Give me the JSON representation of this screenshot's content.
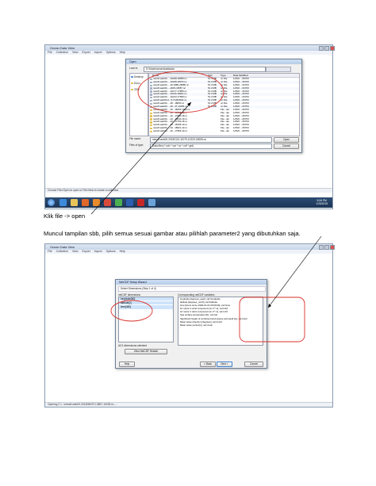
{
  "screenshot1": {
    "app_title": "Ocean Data View",
    "menu": [
      "File",
      "Collection",
      "View",
      "Export",
      "Import",
      "Options",
      "Help"
    ],
    "status_text": "Choose File>Open to open or File>New to create a collection.",
    "dialog": {
      "title": "Open",
      "look_in_label": "Look in:",
      "look_in_value": "D:\\Modelocean\\data\\data",
      "sidebar": [
        "Desktop",
        "Docu...",
        "ODV"
      ],
      "columns": [
        "Name",
        "Size",
        "Type",
        "Date Modified"
      ],
      "files": [
        {
          "name": "netcdf-web00-...-10228-18055.nc",
          "size": "51.3 MB",
          "type": "nc File",
          "date": "1/25/2...:28 PM"
        },
        {
          "name": "netcdf-web00-...-10228-18072.nc",
          "size": "51.3 MB",
          "type": "nc File",
          "date": "1/25/2...:28 PM"
        },
        {
          "name": "netcdf-web00-...-20.0086-28685.nc",
          "size": "51.3 MB",
          "type": "nc File",
          "date": "1/25/2...:30 PM"
        },
        {
          "name": "netcdf-web00-...-2015-18357.nc",
          "size": "51.3 MB",
          "type": "nc File",
          "date": "1/25/2...:30 PM"
        },
        {
          "name": "netcdf-web00-...-10177-17855.nc",
          "size": "51.3 MB",
          "type": "nc File",
          "date": "1/25/2...:30 PM"
        },
        {
          "name": "netcdf-web00-...-10146-18201.nc",
          "size": "51.3 MB",
          "type": "nc File",
          "date": "1/25/2...:29 PM"
        },
        {
          "name": "netcdf-web00-...-10213-17695.nc",
          "size": "51.3 MB",
          "type": "nc File",
          "date": "1/25/2...:29 PM"
        },
        {
          "name": "netcdf-web00-2...5-7148-8911.nc",
          "size": "51.3 MB",
          "type": "nc File",
          "date": "1/25/2...:29 PM"
        },
        {
          "name": "netcdf-web00-...-20...18600.nc",
          "size": "51.3 MB",
          "type": "nc File",
          "date": "1/25/2...:29 PM"
        },
        {
          "name": "netcdf-web00-...-20...27-10251.nc",
          "size": "51.3 MB",
          "type": "nc File",
          "date": "1/25/2...:30 PM"
        },
        {
          "name": "netcdf-web00-...-10...16053-1012.nc",
          "size": "",
          "type": "File...der",
          "date": "1/25/2...:28 PM"
        },
        {
          "name": "netcdf-web00-...-10...13785-16.nc",
          "size": "",
          "type": "File...der",
          "date": "1/25/2...:28 PM"
        },
        {
          "name": "netcdf-web00-...-10...17960-18.nc",
          "size": "",
          "type": "File...der",
          "date": "1/25/2...:28 PM"
        },
        {
          "name": "netcdf-web00-...-10...18030-10.nc",
          "size": "",
          "type": "File...der",
          "date": "1/25/2...:28 PM"
        },
        {
          "name": "netcdf-web00-...-10...17700-16.nc",
          "size": "",
          "type": "File...der",
          "date": "1/25/2...:28 PM"
        },
        {
          "name": "netcdf-web00-...-10...18195-10.nc",
          "size": "",
          "type": "File...der",
          "date": "1/25/2...:28 PM"
        },
        {
          "name": "netcdf-web00-...-10...18021-10.nc",
          "size": "",
          "type": "File...der",
          "date": "1/25/2...:28 PM"
        },
        {
          "name": "netcdf-web00-...-10...17966-10.nc",
          "size": "",
          "type": "File...der",
          "date": "1/25/2...:28 PM"
        }
      ],
      "filename_label": "File name:",
      "filename_value": "netcdf-web00-20150113-11079-10220-18055.nc",
      "filetype_label": "Files of type:",
      "filetype_value": "Data files (*.odv *.var *.nc *.cdf *.grd)",
      "open_label": "Open",
      "cancel_label": "Cancel"
    },
    "clock": "5:06 PM",
    "date": "1/25/2015"
  },
  "caption1": "Klik file -> open",
  "caption2": "Muncul tampilan sbb, pilih semua sesuai gambar atau pilihlah parameter2 yang dibutuhkan saja.",
  "screenshot2": {
    "app_title": "Ocean Data View",
    "menu": [
      "File",
      "Collection",
      "View",
      "Export",
      "Import",
      "Options",
      "Help"
    ],
    "status_text": "Opening C:\\...\\netcdf-web00-20150803T2-3857-10039.nc ...",
    "dialog": {
      "title": "NetCDF Setup Wizard",
      "subtitle": "Select Dimensions (Step 1 of 4)",
      "left_header": "netCDF dimensions",
      "dimensions": [
        "longitude[80]",
        "latitude[2]",
        "time[480]"
      ],
      "selected_info": "All 3 dimensions selected",
      "view_header_btn": "View NetCDF Header",
      "right_header": "Corresponding netCDF variables",
      "variables": [
        "longitude [degrees_east], var=longitude",
        "latitude [degrees_north], var=latitude",
        "time [hours since 1900-01-01 00:00:00], var=time",
        "10 metre U wind component [m s**-1], var=u10",
        "10 metre V wind component [m s**-1], var=v10",
        "Sea surface temperature [K], var=sst",
        "Significant height of combined wind waves and swell [m], var=swh",
        "Mean wave direction [degrees], var=mwd",
        "Mean wave period [s], var=mwp"
      ],
      "help_label": "Help",
      "back_label": "< Back",
      "next_label": "Next >",
      "cancel_label": "Cancel"
    }
  },
  "colors": {
    "annotation_red": "#d9302a",
    "taskbar": "#1f3a5f",
    "selection": "#cfe3fb"
  }
}
